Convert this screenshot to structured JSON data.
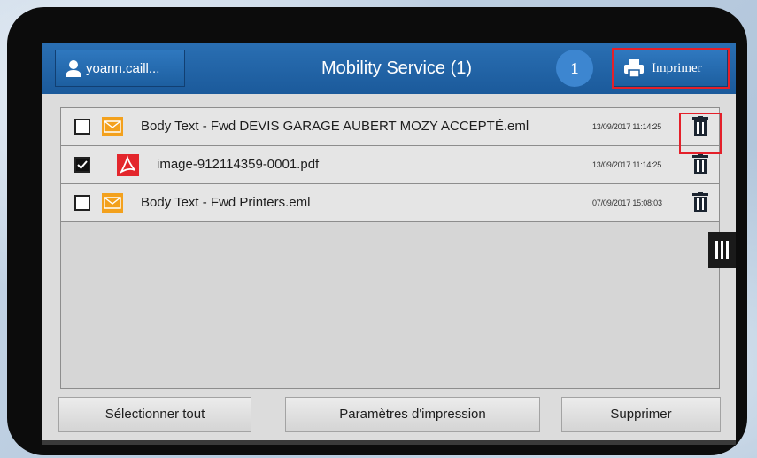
{
  "header": {
    "user": "yoann.caill...",
    "title": "Mobility Service (1)",
    "count": "1",
    "print_label": "Imprimer"
  },
  "files": [
    {
      "name": "Body Text - Fwd DEVIS GARAGE AUBERT MOZY ACCEPTÉ.eml",
      "date": "13/09/2017 11:14:25",
      "type": "email-icon",
      "checked": false
    },
    {
      "name": "image-912114359-0001.pdf",
      "date": "13/09/2017 11:14:25",
      "type": "pdf-icon",
      "checked": true
    },
    {
      "name": "Body Text - Fwd Printers.eml",
      "date": "07/09/2017 15:08:03",
      "type": "email-icon",
      "checked": false
    }
  ],
  "footer": {
    "select_all": "Sélectionner tout",
    "print_settings": "Paramètres d'impression",
    "delete": "Supprimer"
  },
  "colors": {
    "header_blue": "#1b5a9b",
    "highlight_red": "#e4202a",
    "email_orange": "#f3a11d",
    "pdf_red": "#e3262c"
  }
}
